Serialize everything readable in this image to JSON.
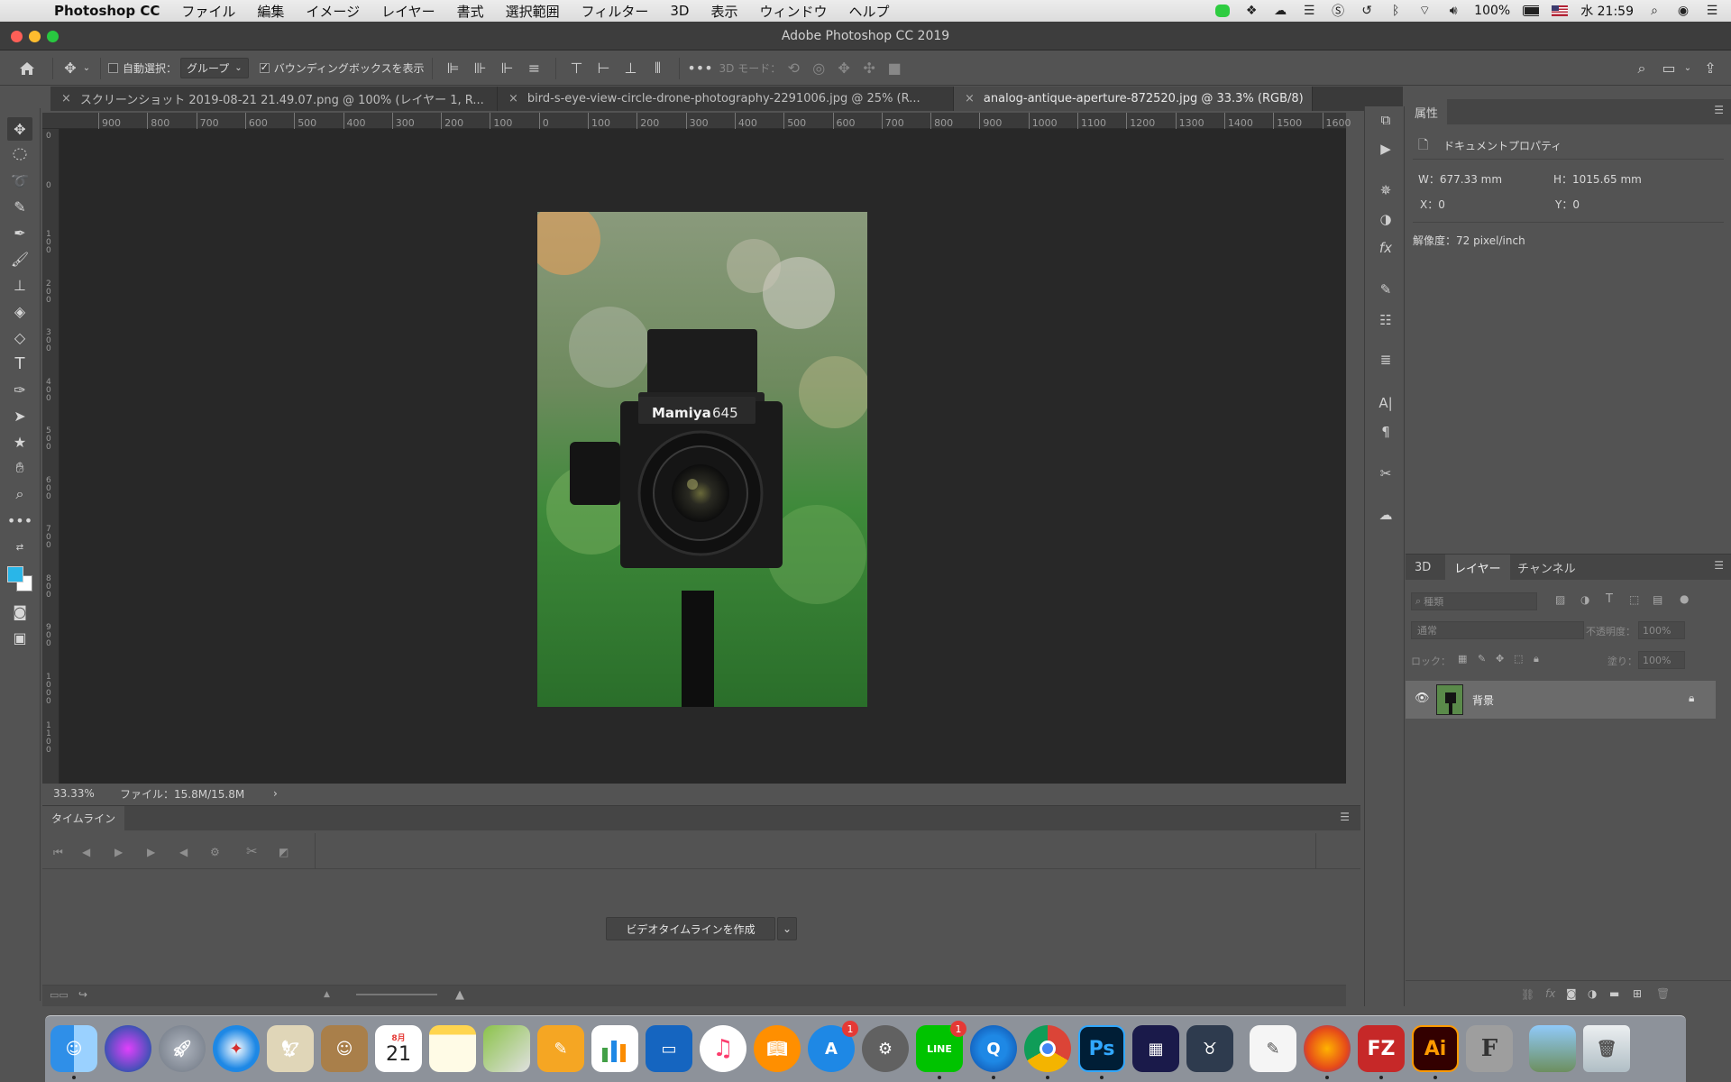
{
  "menubar": {
    "app_name": "Photoshop CC",
    "items": [
      "ファイル",
      "編集",
      "イメージ",
      "レイヤー",
      "書式",
      "選択範囲",
      "フィルター",
      "3D",
      "表示",
      "ウィンドウ",
      "ヘルプ"
    ],
    "battery": "100%",
    "clock": "水 21:59"
  },
  "window": {
    "title": "Adobe Photoshop CC 2019"
  },
  "options_bar": {
    "auto_select_label": "自動選択：",
    "auto_select_value": "グループ",
    "bounding_box_label": "バウンディングボックスを表示",
    "mode_3d_label": "3D モード："
  },
  "tabs": [
    {
      "label": "スクリーンショット 2019-08-21 21.49.07.png @ 100% (レイヤー 1, R...",
      "active": false
    },
    {
      "label": "bird-s-eye-view-circle-drone-photography-2291006.jpg @ 25% (R...",
      "active": false
    },
    {
      "label": "analog-antique-aperture-872520.jpg @ 33.3% (RGB/8)",
      "active": true
    }
  ],
  "ruler": {
    "h_ticks": [
      "900",
      "800",
      "700",
      "600",
      "500",
      "400",
      "300",
      "200",
      "100",
      "0",
      "100",
      "200",
      "300",
      "400",
      "500",
      "600",
      "700",
      "800",
      "900",
      "1000",
      "1100",
      "1200",
      "1300",
      "1400",
      "1500",
      "1600"
    ],
    "v_ticks": [
      "0",
      "0",
      "1 0 0",
      "2 0 0",
      "3 0 0",
      "4 0 0",
      "5 0 0",
      "6 0 0",
      "7 0 0",
      "8 0 0",
      "9 0 0",
      "1 0 0 0",
      "1 1 0 0"
    ]
  },
  "document": {
    "camera_brand": "Mamiya",
    "camera_model": "645"
  },
  "status": {
    "zoom": "33.33%",
    "file_info": "ファイル：15.8M/15.8M"
  },
  "timeline": {
    "tab_label": "タイムライン",
    "create_button": "ビデオタイムラインを作成"
  },
  "properties": {
    "tab_label": "属性",
    "section_label": "ドキュメントプロパティ",
    "w": "W：677.33 mm",
    "h": "H：1015.65 mm",
    "x": "X：0",
    "y": "Y：0",
    "resolution": "解像度：72 pixel/inch"
  },
  "layers_panel": {
    "tabs": [
      "3D",
      "レイヤー",
      "チャンネル"
    ],
    "active_tab": "レイヤー",
    "filter_placeholder": "種類",
    "blend_mode": "通常",
    "opacity_label": "不透明度：",
    "opacity_value": "100%",
    "lock_label": "ロック：",
    "fill_label": "塗り：",
    "fill_value": "100%",
    "layers": [
      {
        "name": "背景",
        "visible": true,
        "locked": true
      }
    ]
  },
  "dock": {
    "apps": [
      "Finder",
      "Siri",
      "Launchpad",
      "Safari",
      "Preview",
      "Contacts",
      "Calendar",
      "Notes",
      "Maps",
      "Pages",
      "Numbers",
      "Keynote",
      "Music",
      "Books",
      "App Store",
      "System Preferences",
      "LINE",
      "QuickTime",
      "Chrome",
      "Photoshop",
      "Media Encoder",
      "Bull",
      "TextEdit",
      "Firefox",
      "FileZilla",
      "Illustrator",
      "Font",
      "Photos",
      "Trash"
    ],
    "calendar_month": "8月",
    "calendar_day": "21",
    "appstore_badge": "1",
    "line_badge": "1",
    "ps_label": "Ps",
    "ai_label": "Ai",
    "fz_label": "FZ",
    "font_label": "F",
    "line_label": "LINE"
  },
  "colors": {
    "foreground": "#29b6e8",
    "background": "#ffffff",
    "canvas": "#282828",
    "panel": "#535353"
  }
}
